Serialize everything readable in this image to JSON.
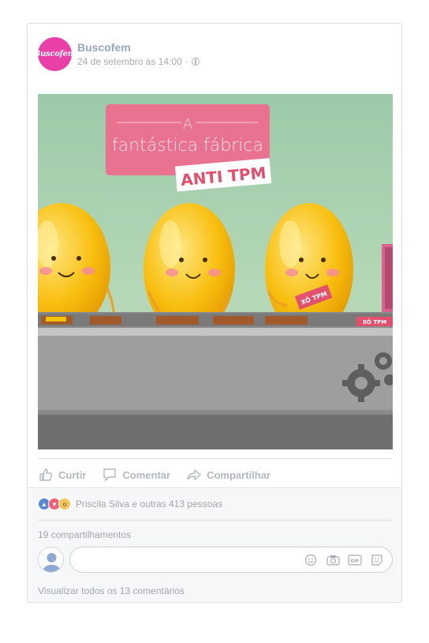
{
  "post": {
    "page_name": "Buscofem",
    "avatar_text": "Buscofem",
    "timestamp": "24 de setembro às 14:00",
    "meta_separator": "·",
    "privacy_icon": "globe-icon"
  },
  "media": {
    "banner_line1": "A",
    "banner_line2": "fantástica fábrica",
    "banner_tag": "ANTI TPM",
    "box_label_1": "XÔ TPM",
    "box_label_2": "XÔ TPM",
    "colors": {
      "background": "#a8cfb1",
      "banner": "#e8728f",
      "capsule": "#f6b600",
      "belt": "#9a9a9a"
    }
  },
  "actions": [
    {
      "label": "Curtir",
      "icon": "thumbs-up-icon"
    },
    {
      "label": "Comentar",
      "icon": "comment-icon"
    },
    {
      "label": "Compartilhar",
      "icon": "share-icon"
    }
  ],
  "footer": {
    "reactions_text": "Priscila Silva e outras 413 pessoas",
    "shares_text": "19 compartilhamentos",
    "comment_placeholder": "",
    "view_all_comments": "Visualizar todos os 13 comentários"
  }
}
